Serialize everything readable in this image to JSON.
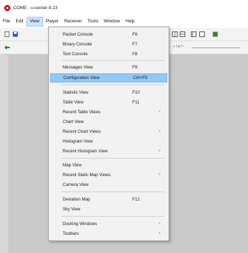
{
  "window": {
    "title": "COME - u-center 8.23"
  },
  "menubar": {
    "items": [
      "File",
      "Edit",
      "View",
      "Player",
      "Receiver",
      "Tools",
      "Window",
      "Help"
    ],
    "active_index": 2
  },
  "toolbar": {
    "right_text": "» I◂ ⊢"
  },
  "view_menu": {
    "items": [
      {
        "label": "Packet Console",
        "shortcut": "F6",
        "submenu": false
      },
      {
        "label": "Binary Console",
        "shortcut": "F7",
        "submenu": false
      },
      {
        "label": "Text Console",
        "shortcut": "F8",
        "submenu": false
      },
      {
        "label": "Messages View",
        "shortcut": "F9",
        "submenu": false
      },
      {
        "label": "Configuration View",
        "shortcut": "Ctrl+F9",
        "submenu": false,
        "highlighted": true
      },
      {
        "label": "Statistic View",
        "shortcut": "F10",
        "submenu": false
      },
      {
        "label": "Table View",
        "shortcut": "F11",
        "submenu": false
      },
      {
        "label": "Recent Table Views",
        "shortcut": "",
        "submenu": true
      },
      {
        "label": "Chart View",
        "shortcut": "",
        "submenu": false
      },
      {
        "label": "Recent Chart Views",
        "shortcut": "",
        "submenu": true
      },
      {
        "label": "Histogram View",
        "shortcut": "",
        "submenu": false
      },
      {
        "label": "Recent Histogram View",
        "shortcut": "",
        "submenu": true
      },
      {
        "label": "Map View",
        "shortcut": "",
        "submenu": false
      },
      {
        "label": "Recent Static Map Views",
        "shortcut": "",
        "submenu": true
      },
      {
        "label": "Camera View",
        "shortcut": "",
        "submenu": false
      },
      {
        "label": "Deviation Map",
        "shortcut": "F12",
        "submenu": false
      },
      {
        "label": "Sky View",
        "shortcut": "",
        "submenu": false
      },
      {
        "label": "Docking Windows",
        "shortcut": "",
        "submenu": true
      },
      {
        "label": "Toolbars",
        "shortcut": "",
        "submenu": true
      }
    ],
    "submenu_arrow": "›"
  },
  "colors": {
    "highlight": "#91c9f7",
    "logo": "#c8191e",
    "menu_active": "#cce4f7"
  }
}
